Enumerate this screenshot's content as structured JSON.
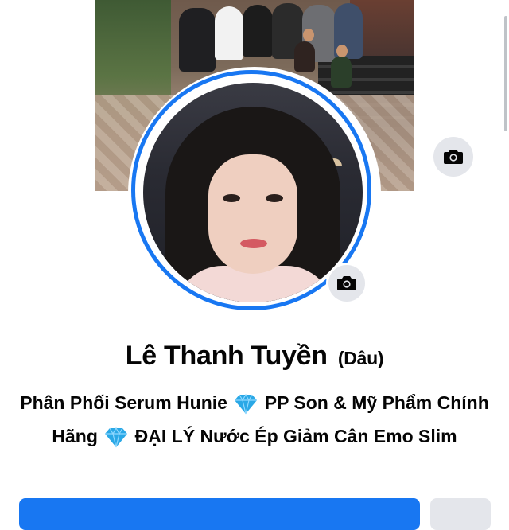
{
  "profile": {
    "name": "Lê Thanh Tuyền",
    "alternate_name": "(Dâu)",
    "bio_parts": [
      "Phân Phối Serum Hunie ",
      " PP Son & Mỹ Phẩm Chính Hãng ",
      " ĐẠI LÝ Nước Ép Giảm Cân Emo Slim"
    ]
  },
  "icons": {
    "cover_camera": "camera-icon",
    "avatar_camera": "camera-icon",
    "bio_gem": "gem-icon"
  },
  "colors": {
    "accent": "#1877f2",
    "secondary_button": "#e4e6eb",
    "text": "#050505",
    "gem": "#2aa8e6"
  }
}
